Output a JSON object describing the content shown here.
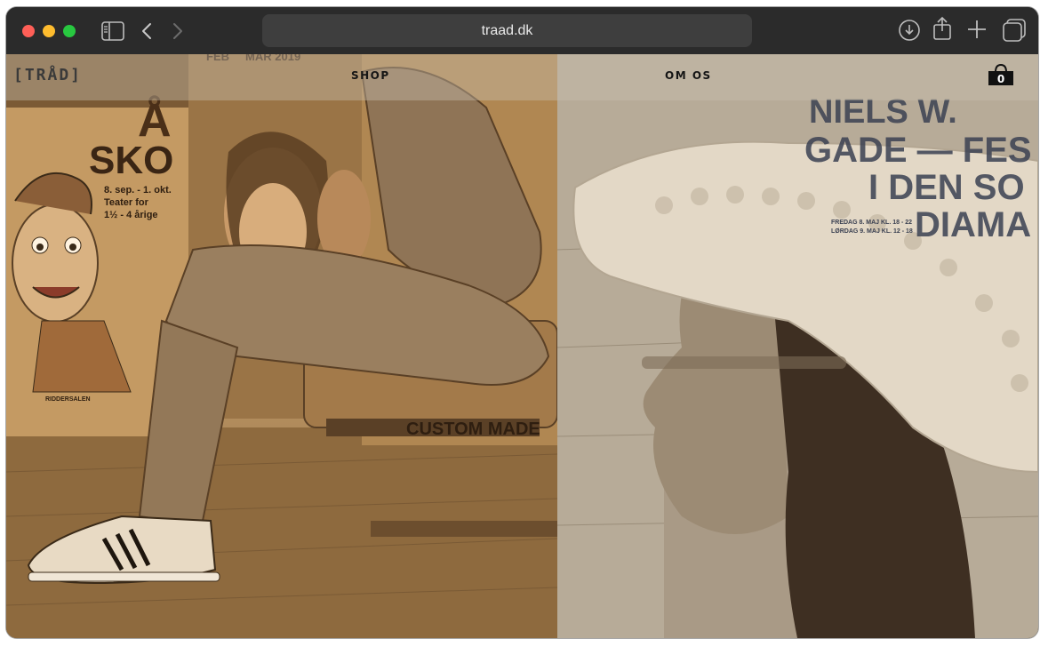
{
  "browser": {
    "url": "traad.dk",
    "icons": [
      "sidebar-icon",
      "back-icon",
      "forward-icon",
      "download-icon",
      "share-icon",
      "new-tab-icon",
      "tab-overview-icon"
    ]
  },
  "site": {
    "logo": "[TRÅD]",
    "nav": {
      "shop": "SHOP",
      "om_os": "OM OS"
    },
    "cart_count": "0"
  },
  "photo_left": {
    "poster_title": "SKO",
    "poster_title_top": "Å",
    "poster_lines": [
      "8. sep. - 1. okt.",
      "Teater for",
      "1½ - 4 årige"
    ],
    "poster_venue": "RIDDERSALEN",
    "poster_top": "FEB     MAR 2019",
    "bench_sign": "CUSTOM MADE"
  },
  "photo_right": {
    "poster_lines": [
      "NIELS W.",
      "GADE — FES",
      "I DEN SO",
      "DIAMA"
    ],
    "poster_small": [
      "FREDAG 8. MAJ KL. 18 - 22",
      "LØRDAG 9. MAJ KL. 12 - 18"
    ]
  },
  "colors": {
    "sepia": "#a57f4f",
    "nav_text": "#151515",
    "toolbar": "#2b2b2b"
  }
}
